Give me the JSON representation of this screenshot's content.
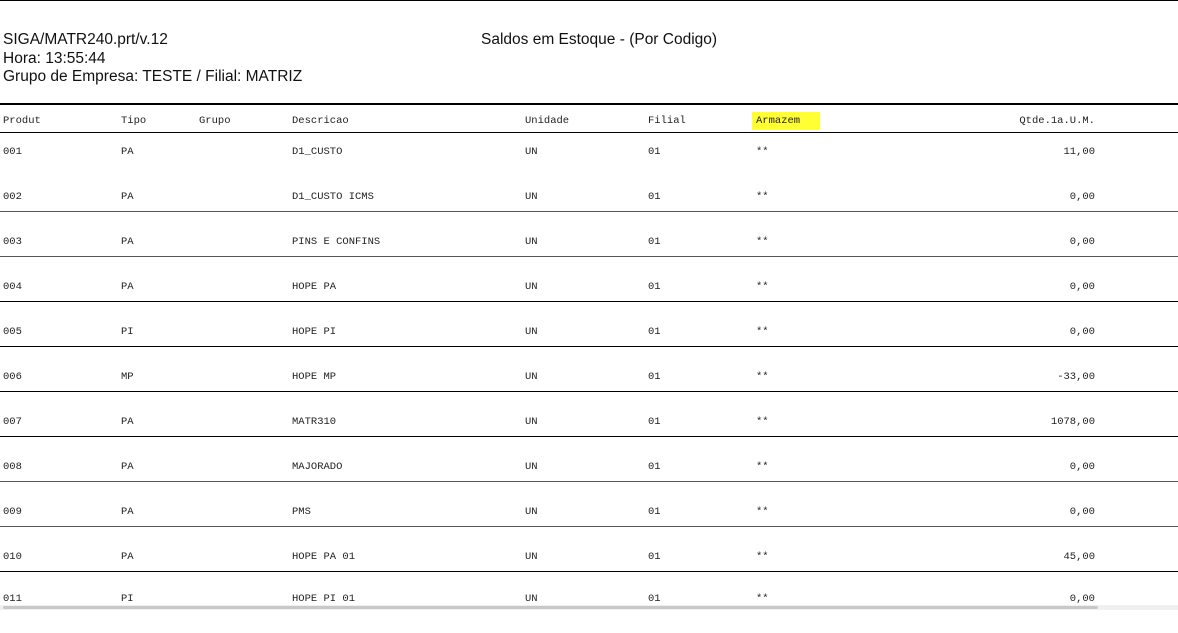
{
  "report": {
    "program": "SIGA/MATR240.prt/v.12",
    "time": "Hora: 13:55:44",
    "company": "Grupo de Empresa: TESTE / Filial: MATRIZ",
    "title": "Saldos em Estoque - (Por Codigo)"
  },
  "table": {
    "columns": {
      "produto": "Produt",
      "tipo": "Tipo",
      "grupo": "Grupo",
      "descricao": "Descricao",
      "unidade": "Unidade",
      "filial": "Filial",
      "armazem": "Armazem",
      "qtde": "Qtde.1a.U.M."
    },
    "rows": [
      {
        "produto": "001",
        "tipo": "PA",
        "grupo": "",
        "descricao": "D1_CUSTO",
        "unidade": "UN",
        "filial": "01",
        "armazem": "**",
        "qtde": "11,00"
      },
      {
        "produto": "002",
        "tipo": "PA",
        "grupo": "",
        "descricao": "D1_CUSTO ICMS",
        "unidade": "UN",
        "filial": "01",
        "armazem": "**",
        "qtde": "0,00"
      },
      {
        "produto": "003",
        "tipo": "PA",
        "grupo": "",
        "descricao": "PINS E CONFINS",
        "unidade": "UN",
        "filial": "01",
        "armazem": "**",
        "qtde": "0,00"
      },
      {
        "produto": "004",
        "tipo": "PA",
        "grupo": "",
        "descricao": "HOPE PA",
        "unidade": "UN",
        "filial": "01",
        "armazem": "**",
        "qtde": "0,00"
      },
      {
        "produto": "005",
        "tipo": "PI",
        "grupo": "",
        "descricao": "HOPE PI",
        "unidade": "UN",
        "filial": "01",
        "armazem": "**",
        "qtde": "0,00"
      },
      {
        "produto": "006",
        "tipo": "MP",
        "grupo": "",
        "descricao": "HOPE MP",
        "unidade": "UN",
        "filial": "01",
        "armazem": "**",
        "qtde": "-33,00"
      },
      {
        "produto": "007",
        "tipo": "PA",
        "grupo": "",
        "descricao": "MATR310",
        "unidade": "UN",
        "filial": "01",
        "armazem": "**",
        "qtde": "1078,00"
      },
      {
        "produto": "008",
        "tipo": "PA",
        "grupo": "",
        "descricao": "MAJORADO",
        "unidade": "UN",
        "filial": "01",
        "armazem": "**",
        "qtde": "0,00"
      },
      {
        "produto": "009",
        "tipo": "PA",
        "grupo": "",
        "descricao": "PMS",
        "unidade": "UN",
        "filial": "01",
        "armazem": "**",
        "qtde": "0,00"
      },
      {
        "produto": "010",
        "tipo": "PA",
        "grupo": "",
        "descricao": "HOPE PA 01",
        "unidade": "UN",
        "filial": "01",
        "armazem": "**",
        "qtde": "45,00"
      },
      {
        "produto": "011",
        "tipo": "PI",
        "grupo": "",
        "descricao": "HOPE PI 01",
        "unidade": "UN",
        "filial": "01",
        "armazem": "**",
        "qtde": "0,00"
      }
    ]
  },
  "colors": {
    "highlight": "#ffff33",
    "rule": "#000000"
  }
}
